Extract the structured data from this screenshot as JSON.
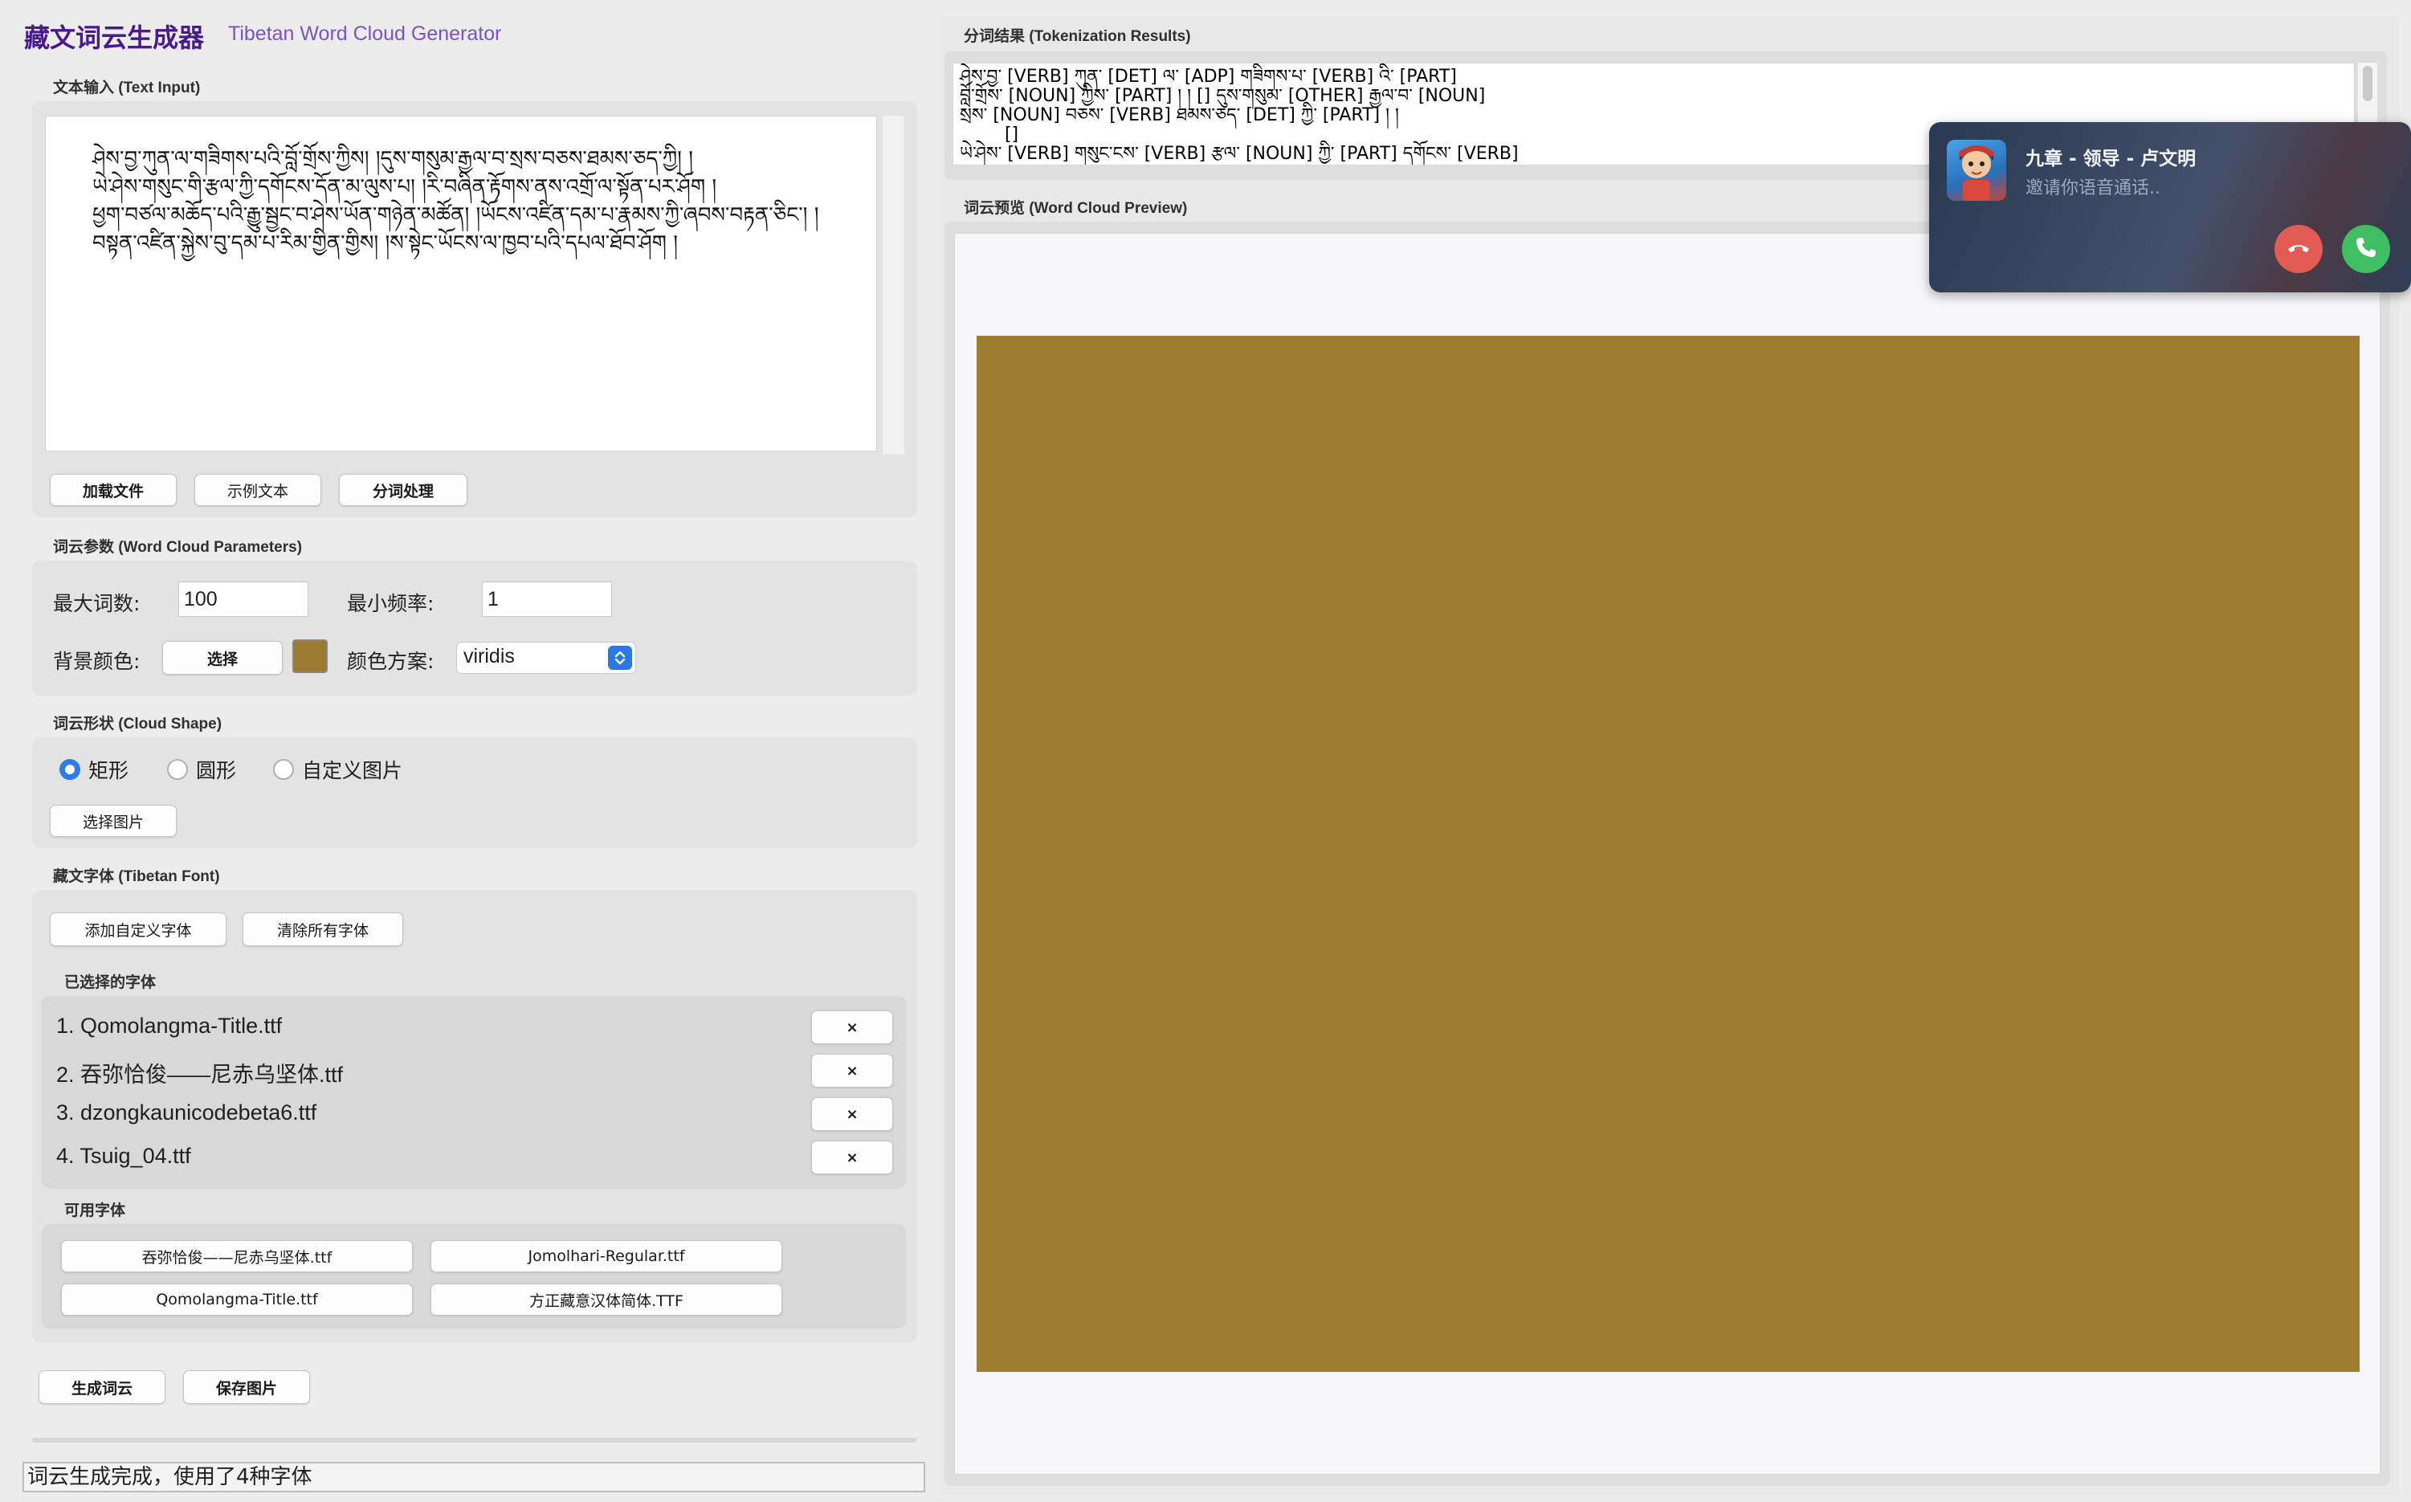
{
  "app": {
    "title": "藏文词云生成器",
    "subtitle": "Tibetan Word Cloud Generator"
  },
  "text_input": {
    "section_label": "文本输入 (Text Input)",
    "lines": [
      "ཤེས་བྱ་ཀུན་ལ་གཟིགས་པའི་བློ་གྲོས་ཀྱིས། །དུས་གསུམ་རྒྱལ་བ་སྲས་བཅས་ཐམས་ཅད་ཀྱི། །",
      "ཡེ་ཤེས་གསུང་གི་རྩལ་ཀྱི་དགོངས་དོན་མ་ལུས་པ། །རི་བཞིན་རྟོགས་ནས་འགྲོ་ལ་སྟོན་པར་ཤོག །",
      "ཕྱག་བཙལ་མཆོད་པའི་རྒྱུ་སྦྱང་བ་ཤེས་ཡོན་གཉེན་མཚོན། །ཡོངས་འཛིན་དམ་པ་རྣམས་ཀྱི་ཞབས་བརྟན་ཅིང་། །",
      "བསྟན་འཛིན་སྐྱེས་བུ་དམ་པ་རིམ་གྱིན་གྱིས། །ས་སྟེང་ཡོངས་ལ་ཁྱབ་པའི་དཔལ་ཐོབ་ཤོག །"
    ],
    "buttons": {
      "load": "加载文件",
      "sample": "示例文本",
      "tokenize": "分词处理"
    }
  },
  "params": {
    "section_label": "词云参数 (Word Cloud Parameters)",
    "max_words_label": "最大词数:",
    "max_words_value": "100",
    "min_freq_label": "最小频率:",
    "min_freq_value": "1",
    "bg_color_label": "背景颜色:",
    "choose_label": "选择",
    "bg_color_hex": "#9c7b30",
    "colormap_label": "颜色方案:",
    "colormap_value": "viridis"
  },
  "shape": {
    "section_label": "词云形状 (Cloud Shape)",
    "options": [
      "矩形",
      "圆形",
      "自定义图片"
    ],
    "selected": "矩形",
    "choose_image": "选择图片"
  },
  "font": {
    "section_label": "藏文字体 (Tibetan Font)",
    "add_custom": "添加自定义字体",
    "clear_all": "清除所有字体",
    "selected_label": "已选择的字体",
    "selected_fonts": [
      "1. Qomolangma-Title.ttf",
      "2. 吞弥恰俊——尼赤乌坚体.ttf",
      "3. dzongkaunicodebeta6.ttf",
      "4. Tsuig_04.ttf"
    ],
    "remove_symbol": "×",
    "available_label": "可用字体",
    "available_fonts": [
      "吞弥恰俊——尼赤乌坚体.ttf",
      "Jomolhari-Regular.ttf",
      "Qomolangma-Title.ttf",
      "方正藏意汉体简体.TTF"
    ]
  },
  "actions": {
    "generate": "生成词云",
    "save": "保存图片"
  },
  "status": {
    "text": "词云生成完成，使用了4种字体"
  },
  "tokenization": {
    "section_label": "分词结果 (Tokenization Results)",
    "lines": [
      "ཤེས་བྱ་ [VERB] ཀུན་ [DET] ལ་ [ADP] གཟིགས་པ་ [VERB] འི་ [PART]",
      "བློ་གྲོས་ [NOUN] ཀྱིས་ [PART] ། ། [] དུས་གསུམ་ [OTHER] རྒྱལ་བ་ [NOUN]",
      "སྲས་ [NOUN] བཅས་ [VERB] ཐམས་ཅད་ [DET] ཀྱི་ [PART] ། །",
      "        []",
      "ཡེ་ཤེས་ [VERB] གསུང་ངས་ [VERB] རྩལ་ [NOUN] ཀྱི་ [PART] དགོངས་ [VERB]"
    ]
  },
  "preview": {
    "section_label": "词云预览 (Word Cloud Preview)",
    "canvas_color": "#9f7e31"
  },
  "call_notification": {
    "title": "九章 - 领导 - 卢文明",
    "subtitle": "邀请你语音通话..",
    "decline_icon": "phone-hangup-icon",
    "accept_icon": "phone-icon"
  }
}
